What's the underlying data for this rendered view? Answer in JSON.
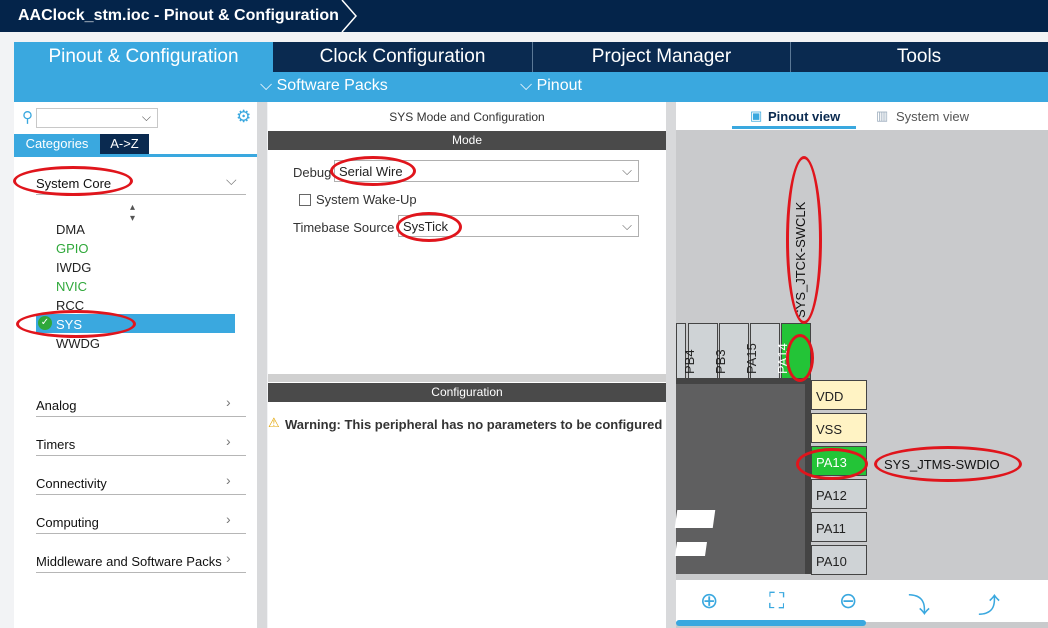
{
  "window": {
    "title": "AAClock_stm.ioc - Pinout & Configuration"
  },
  "tabs": [
    {
      "label": "Pinout & Configuration"
    },
    {
      "label": "Clock Configuration"
    },
    {
      "label": "Project Manager"
    },
    {
      "label": "Tools"
    }
  ],
  "subnav": {
    "software_packs": "Software Packs",
    "pinout": "Pinout"
  },
  "left": {
    "btn_categories": "Categories",
    "btn_az": "A->Z",
    "system_core": "System Core",
    "items": [
      "DMA",
      "GPIO",
      "IWDG",
      "NVIC",
      "RCC",
      "SYS",
      "WWDG"
    ],
    "categories": [
      "Analog",
      "Timers",
      "Connectivity",
      "Computing",
      "Middleware and Software Packs"
    ]
  },
  "mode_panel": {
    "title": "SYS Mode and Configuration",
    "mode_header": "Mode",
    "debug_label": "Debug",
    "debug_value": "Serial Wire",
    "wakeup_label": "System Wake-Up",
    "timebase_label": "Timebase Source",
    "timebase_value": "SysTick",
    "config_header": "Configuration",
    "warning": "Warning: This peripheral has no parameters to be configured"
  },
  "pinout": {
    "pinout_view": "Pinout view",
    "system_view": "System view",
    "top_pins": [
      "PB4",
      "PB3",
      "PA15",
      "PA14"
    ],
    "right_pins": [
      "VDD",
      "VSS",
      "PA13",
      "PA12",
      "PA11",
      "PA10"
    ],
    "label_swclk": "SYS_JTCK-SWCLK",
    "label_swdio": "SYS_JTMS-SWDIO"
  },
  "colors": {
    "accent": "#3aa8df",
    "navy": "#04244a",
    "pin_green": "#23c437",
    "annotation": "#e0151c"
  }
}
